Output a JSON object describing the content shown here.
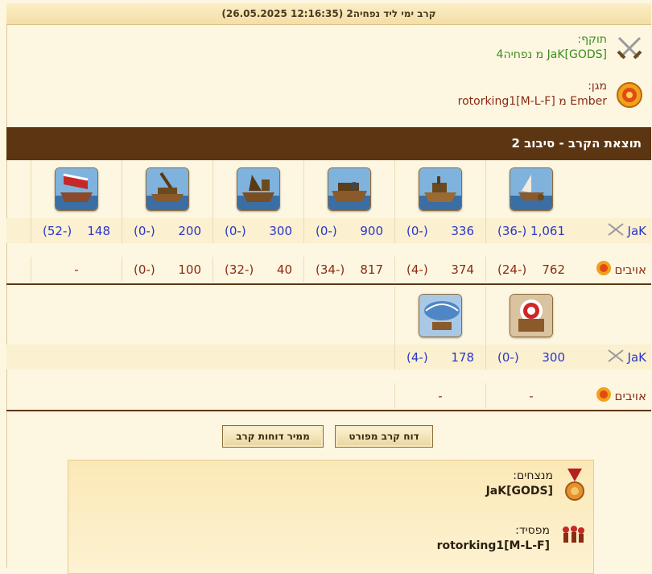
{
  "header": {
    "title": "קרב ימי ליד נפחיה2 (12:16:35 26.05.2025)"
  },
  "attacker": {
    "label": "תוקף:",
    "name": "JaK[GODS] מ נפחיה4"
  },
  "defender": {
    "label": "מגן:",
    "name": "Ember מ rotorking1[M-L-F]"
  },
  "round_banner": "תוצאת הקרב - סיבוב 2",
  "rows_labels": {
    "own": "JaK",
    "enemy": "אויבים"
  },
  "section1": {
    "units": [
      "ship-unit-1",
      "ship-unit-2",
      "ship-unit-3",
      "ship-unit-4",
      "ship-unit-5",
      "ship-unit-6"
    ],
    "own": [
      {
        "count": "1,061",
        "loss": "(-36)"
      },
      {
        "count": "336",
        "loss": "(-0)"
      },
      {
        "count": "900",
        "loss": "(-0)"
      },
      {
        "count": "300",
        "loss": "(-0)"
      },
      {
        "count": "200",
        "loss": "(-0)"
      },
      {
        "count": "148",
        "loss": "(-52)"
      }
    ],
    "enemy": [
      {
        "count": "762",
        "loss": "(-24)"
      },
      {
        "count": "374",
        "loss": "(-4)"
      },
      {
        "count": "817",
        "loss": "(-34)"
      },
      {
        "count": "40",
        "loss": "(-32)"
      },
      {
        "count": "100",
        "loss": "(-0)"
      },
      {
        "count": "-",
        "loss": ""
      }
    ]
  },
  "section2": {
    "own": [
      {
        "count": "300",
        "loss": "(-0)"
      },
      {
        "count": "178",
        "loss": "(-4)"
      }
    ],
    "enemy": [
      {
        "count": "-",
        "loss": ""
      },
      {
        "count": "-",
        "loss": ""
      }
    ]
  },
  "buttons": {
    "detailed": "דוח קרב מפורט",
    "converter": "ממיר דוחות קרב"
  },
  "summary": {
    "winners_label": "מנצחים:",
    "winners": "JaK[GODS]",
    "loser_label": "מפסיד:",
    "loser": "rotorking1[M-L-F]"
  }
}
